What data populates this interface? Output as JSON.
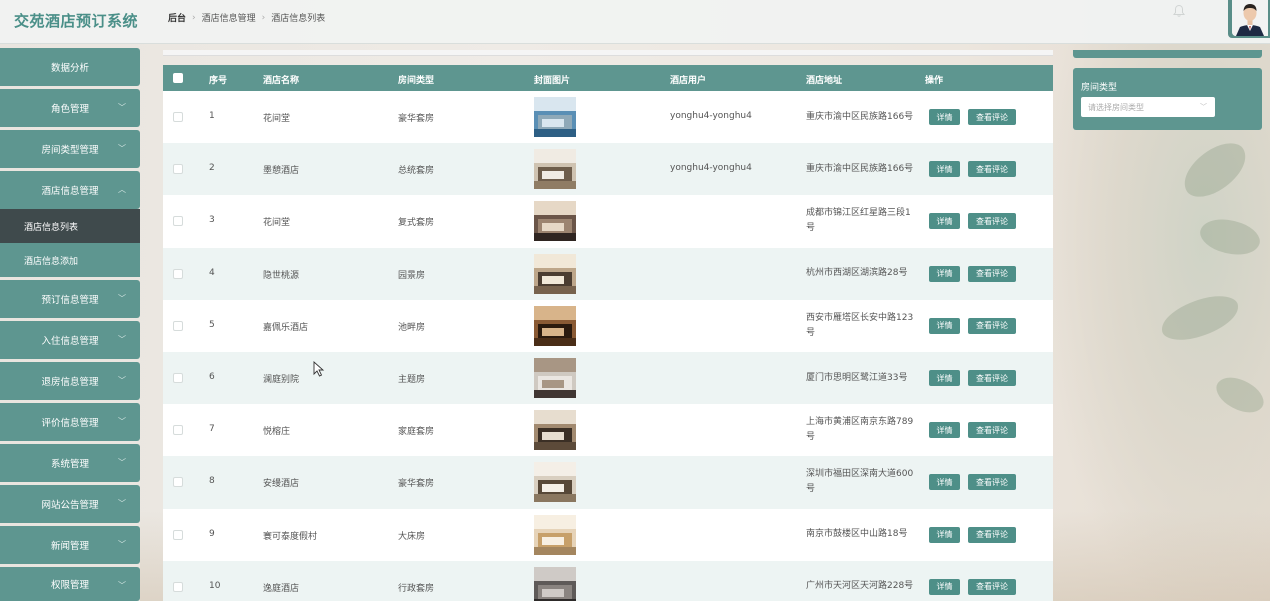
{
  "app": {
    "title": "交苑酒店预订系统"
  },
  "breadcrumb": [
    "后台",
    "酒店信息管理",
    "酒店信息列表"
  ],
  "sidebar": {
    "items": [
      {
        "label": "数据分析",
        "has_children": false
      },
      {
        "label": "角色管理",
        "has_children": true
      },
      {
        "label": "房间类型管理",
        "has_children": true
      },
      {
        "label": "酒店信息管理",
        "has_children": true,
        "expanded": true
      },
      {
        "label": "预订信息管理",
        "has_children": true
      },
      {
        "label": "入住信息管理",
        "has_children": true
      },
      {
        "label": "退房信息管理",
        "has_children": true
      },
      {
        "label": "评价信息管理",
        "has_children": true
      },
      {
        "label": "系统管理",
        "has_children": true
      },
      {
        "label": "网站公告管理",
        "has_children": true
      },
      {
        "label": "新闻管理",
        "has_children": true
      },
      {
        "label": "权限管理",
        "has_children": true
      }
    ],
    "submenu": [
      {
        "label": "酒店信息列表",
        "active": true
      },
      {
        "label": "酒店信息添加",
        "active": false
      }
    ]
  },
  "table": {
    "columns": [
      "序号",
      "酒店名称",
      "房间类型",
      "封面图片",
      "酒店用户",
      "酒店地址",
      "操作"
    ],
    "rows": [
      {
        "index": "1",
        "name": "花间堂",
        "room_type": "豪华套房",
        "user": "yonghu4-yonghu4",
        "address": [
          "重庆市渝中区民族路166号"
        ]
      },
      {
        "index": "2",
        "name": "墨憩酒店",
        "room_type": "总统套房",
        "user": "yonghu4-yonghu4",
        "address": [
          "重庆市渝中区民族路166号"
        ]
      },
      {
        "index": "3",
        "name": "花间堂",
        "room_type": "复式套房",
        "user": "",
        "address": [
          "成都市锦江区红星路三段1",
          "号"
        ]
      },
      {
        "index": "4",
        "name": "隐世桃源",
        "room_type": "园景房",
        "user": "",
        "address": [
          "杭州市西湖区湖滨路28号"
        ]
      },
      {
        "index": "5",
        "name": "嘉佩乐酒店",
        "room_type": "池畔房",
        "user": "",
        "address": [
          "西安市雁塔区长安中路123",
          "号"
        ]
      },
      {
        "index": "6",
        "name": "澜庭别院",
        "room_type": "主题房",
        "user": "",
        "address": [
          "厦门市思明区鹭江道33号"
        ]
      },
      {
        "index": "7",
        "name": "悦榕庄",
        "room_type": "家庭套房",
        "user": "",
        "address": [
          "上海市黄浦区南京东路789",
          "号"
        ]
      },
      {
        "index": "8",
        "name": "安缦酒店",
        "room_type": "豪华套房",
        "user": "",
        "address": [
          "深圳市福田区深南大道600",
          "号"
        ]
      },
      {
        "index": "9",
        "name": "寰可泰度假村",
        "room_type": "大床房",
        "user": "",
        "address": [
          "南京市鼓楼区中山路18号"
        ]
      },
      {
        "index": "10",
        "name": "逸庭酒店",
        "room_type": "行政套房",
        "user": "",
        "address": [
          "广州市天河区天河路228号"
        ]
      }
    ],
    "detail_label": "详情",
    "review_label": "查看评论"
  },
  "filter": {
    "label": "房间类型",
    "placeholder": "请选择房间类型"
  },
  "colors": {
    "primary": "#5e9690",
    "button": "#4e8f88",
    "brand_text": "#4a8f88",
    "row_alt": "#edf4f3"
  },
  "icons": [
    "bell-icon",
    "chevron-down-icon",
    "chevron-up-icon",
    "cursor-icon"
  ]
}
